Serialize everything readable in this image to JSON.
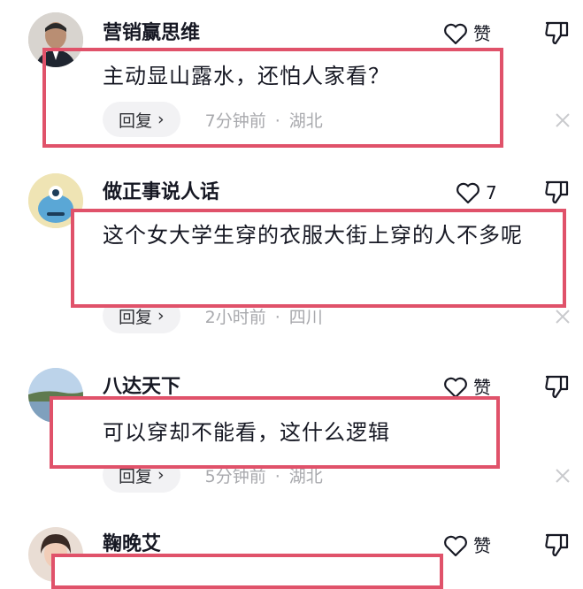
{
  "like_label": "赞",
  "reply_label": "回复",
  "colors": {
    "highlight": "#e0526a",
    "meta": "#a8a9ad",
    "reply_bg": "#f2f2f4"
  },
  "comments": [
    {
      "username": "营销赢思维",
      "text": "主动显山露水，还怕人家看？",
      "likes": "赞",
      "time": "7分钟前",
      "location": "湖北"
    },
    {
      "username": "做正事说人话",
      "text": "这个女大学生穿的衣服大街上穿的人不多呢",
      "likes": "7",
      "time": "2小时前",
      "location": "四川"
    },
    {
      "username": "八达天下",
      "text": "可以穿却不能看，这什么逻辑",
      "likes": "赞",
      "time": "5分钟前",
      "location": "湖北"
    },
    {
      "username": "鞠晚艾",
      "text": "",
      "likes": "赞",
      "time": "",
      "location": ""
    }
  ],
  "icons": {
    "like": "heart-outline-icon",
    "dislike": "thumbs-down-icon",
    "close": "close-icon",
    "reply_chevron": "chevron-right-icon"
  }
}
